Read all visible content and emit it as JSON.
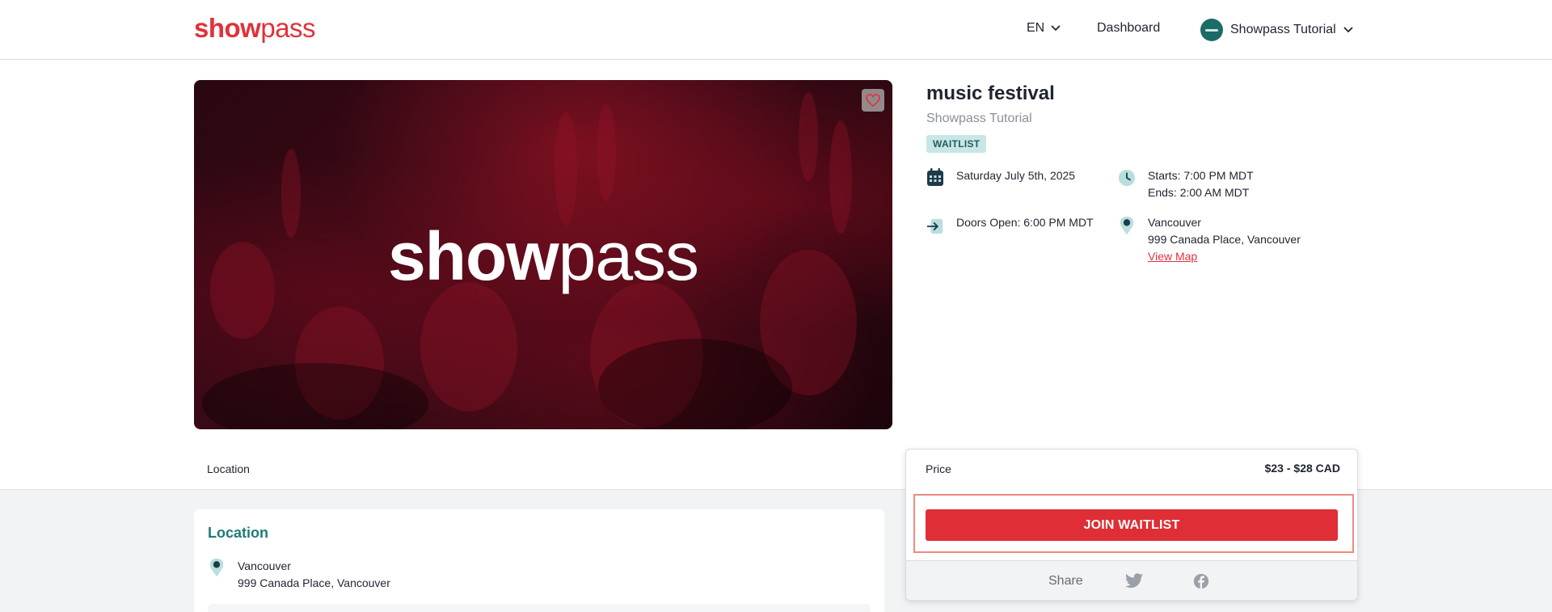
{
  "header": {
    "logo": {
      "bold": "show",
      "light": "pass"
    },
    "language": "EN",
    "dashboard": "Dashboard",
    "user_name": "Showpass Tutorial"
  },
  "hero": {
    "logo": {
      "bold": "show",
      "light": "pass"
    }
  },
  "event": {
    "title": "music festival",
    "organizer": "Showpass Tutorial",
    "badge": "WAITLIST",
    "date": "Saturday July 5th, 2025",
    "starts": "Starts: 7:00 PM MDT",
    "ends": "Ends: 2:00 AM MDT",
    "doors": "Doors Open: 6:00 PM MDT",
    "venue": "Vancouver",
    "address": "999 Canada Place, Vancouver",
    "view_map": "View Map"
  },
  "tabs": {
    "location": "Location"
  },
  "location_section": {
    "title": "Location",
    "venue": "Vancouver",
    "address": "999 Canada Place, Vancouver"
  },
  "purchase": {
    "price_label": "Price",
    "price_value": "$23 - $28 CAD",
    "button": "JOIN WAITLIST",
    "share_label": "Share"
  },
  "colors": {
    "brand_red": "#e0323a",
    "teal": "#1f7a78",
    "badge_bg": "#c9e6e6"
  },
  "icons": [
    "chevron-down-icon",
    "heart-icon",
    "calendar-icon",
    "clock-icon",
    "arrow-right-icon",
    "map-pin-icon",
    "twitter-icon",
    "facebook-icon"
  ]
}
